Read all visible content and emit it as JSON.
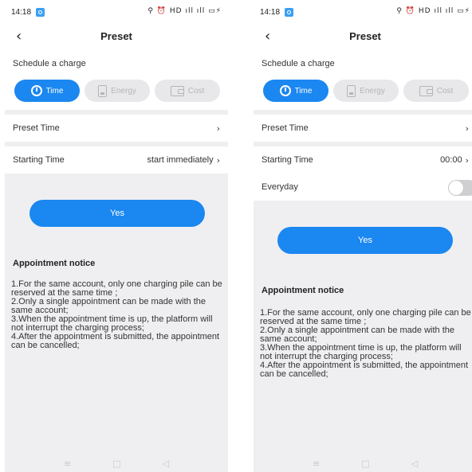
{
  "screens": [
    {
      "status": {
        "time": "14:18",
        "icons": "⚲ ⏰ HD ıll ıll ▭⚡"
      },
      "nav": {
        "title": "Preset",
        "back_icon": "chevron-left-icon"
      },
      "schedule": {
        "label": "Schedule a charge",
        "tabs": [
          {
            "label": "Time",
            "active": true,
            "icon": "clock-icon"
          },
          {
            "label": "Energy",
            "active": false,
            "icon": "battery-icon"
          },
          {
            "label": "Cost",
            "active": false,
            "icon": "wallet-icon"
          }
        ]
      },
      "preset_time": {
        "label": "Preset Time"
      },
      "starting_time": {
        "label": "Starting Time",
        "value": "start immediately"
      },
      "yes_label": "Yes",
      "notice": {
        "title": "Appointment notice",
        "body": "1.For the same account, only one charging pile can be reserved at the same time ;\n2.Only a single appointment can be made with the same account;\n3.When the appointment time is up, the platform will not interrupt the charging process;\n4.After the appointment is submitted, the appointment can be cancelled;"
      },
      "system_nav": {
        "menu": "≡",
        "home": "□",
        "back": "◁"
      }
    },
    {
      "status": {
        "time": "14:18",
        "icons": "⚲ ⏰ HD ıll ıll ▭⚡"
      },
      "nav": {
        "title": "Preset",
        "back_icon": "chevron-left-icon"
      },
      "schedule": {
        "label": "Schedule a charge",
        "tabs": [
          {
            "label": "Time",
            "active": true,
            "icon": "clock-icon"
          },
          {
            "label": "Energy",
            "active": false,
            "icon": "battery-icon"
          },
          {
            "label": "Cost",
            "active": false,
            "icon": "wallet-icon"
          }
        ]
      },
      "preset_time": {
        "label": "Preset Time"
      },
      "starting_time": {
        "label": "Starting Time",
        "value": "00:00"
      },
      "everyday": {
        "label": "Everyday",
        "enabled": false
      },
      "yes_label": "Yes",
      "notice": {
        "title": "Appointment notice",
        "body": "1.For the same account, only one charging pile can be reserved at the same time ;\n2.Only a single appointment can be made with the same account;\n3.When the appointment time is up, the platform will not interrupt the charging process;\n4.After the appointment is submitted, the appointment can be cancelled;"
      },
      "system_nav": {
        "menu": "≡",
        "home": "□",
        "back": "◁"
      }
    }
  ],
  "colors": {
    "accent": "#1b87f0",
    "background": "#efeff1",
    "inactive_tab": "#e8e8ea"
  }
}
